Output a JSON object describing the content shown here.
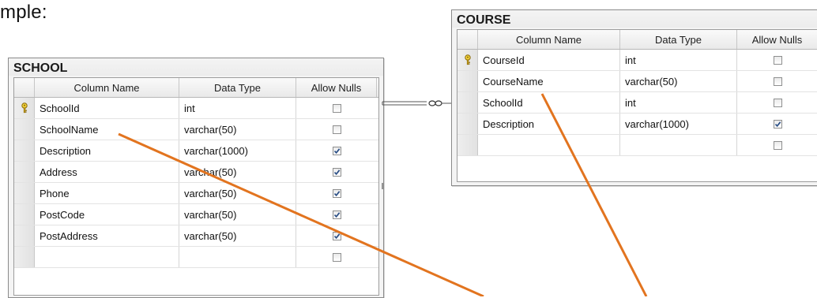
{
  "caption": "mple:",
  "school": {
    "title": "SCHOOL",
    "headers": [
      "Column Name",
      "Data Type",
      "Allow Nulls"
    ],
    "rows": [
      {
        "name": "SchoolId",
        "type": "int",
        "nulls": false,
        "key": true
      },
      {
        "name": "SchoolName",
        "type": "varchar(50)",
        "nulls": false,
        "key": false
      },
      {
        "name": "Description",
        "type": "varchar(1000)",
        "nulls": true,
        "key": false
      },
      {
        "name": "Address",
        "type": "varchar(50)",
        "nulls": true,
        "key": false
      },
      {
        "name": "Phone",
        "type": "varchar(50)",
        "nulls": true,
        "key": false
      },
      {
        "name": "PostCode",
        "type": "varchar(50)",
        "nulls": true,
        "key": false
      },
      {
        "name": "PostAddress",
        "type": "varchar(50)",
        "nulls": true,
        "key": false
      },
      {
        "name": "",
        "type": "",
        "nulls": false,
        "key": false
      }
    ]
  },
  "course": {
    "title": "COURSE",
    "headers": [
      "Column Name",
      "Data Type",
      "Allow Nulls"
    ],
    "rows": [
      {
        "name": "CourseId",
        "type": "int",
        "nulls": false,
        "key": true
      },
      {
        "name": "CourseName",
        "type": "varchar(50)",
        "nulls": false,
        "key": false
      },
      {
        "name": "SchoolId",
        "type": "int",
        "nulls": false,
        "key": false
      },
      {
        "name": "Description",
        "type": "varchar(1000)",
        "nulls": true,
        "key": false
      },
      {
        "name": "",
        "type": "",
        "nulls": false,
        "key": false
      }
    ]
  },
  "colors": {
    "arrow": "#e2741f",
    "key": "#d4b21a"
  },
  "icons": {
    "primary_key": "key-icon",
    "relationship": "infinity-icon",
    "checkbox": "checkbox-icon"
  }
}
